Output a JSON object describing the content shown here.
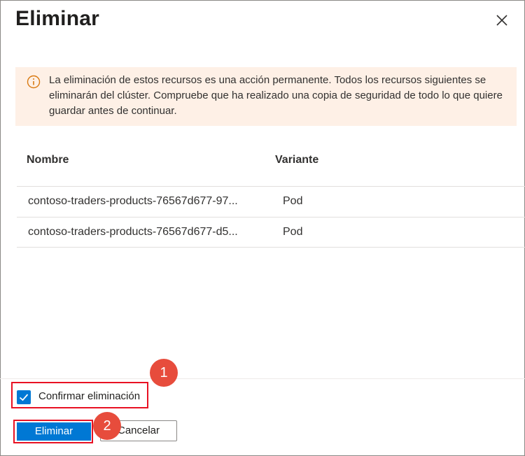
{
  "dialog": {
    "title": "Eliminar",
    "close_icon": "close-icon"
  },
  "warning": {
    "icon": "info-circle-icon",
    "color": "#d97a12",
    "background": "#fef0e6",
    "text": "La eliminación de estos recursos es una acción permanente. Todos los recursos siguientes se eliminarán del clúster. Compruebe que ha realizado una copia de seguridad de todo lo que quiere guardar antes de continuar."
  },
  "table": {
    "columns": [
      "Nombre",
      "Variante"
    ],
    "rows": [
      {
        "name": "contoso-traders-products-76567d677-97...",
        "kind": "Pod"
      },
      {
        "name": "contoso-traders-products-76567d677-d5...",
        "kind": "Pod"
      }
    ]
  },
  "footer": {
    "confirm_label": "Confirmar eliminación",
    "confirm_checked": true,
    "delete_label": "Eliminar",
    "cancel_label": "Cancelar"
  },
  "annotations": {
    "badge_1": "1",
    "badge_2": "2",
    "highlight_color": "#e81123",
    "badge_color": "#e74c3c"
  },
  "colors": {
    "accent": "#0078d4"
  }
}
